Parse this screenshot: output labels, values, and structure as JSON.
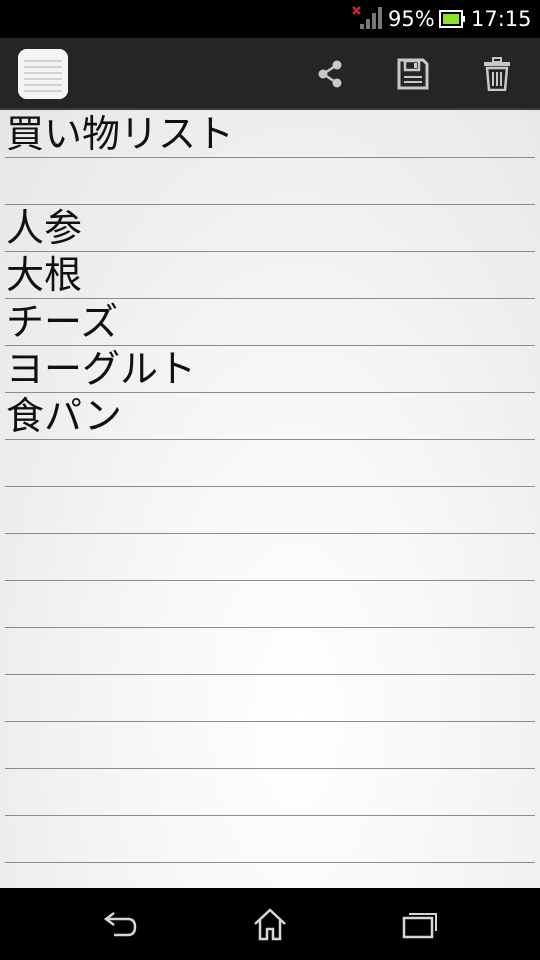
{
  "status_bar": {
    "battery_percent": "95%",
    "time": "17:15",
    "signal_icon": "signal-no-connection-icon",
    "battery_icon": "battery-icon"
  },
  "action_bar": {
    "app_icon": "notepad-icon",
    "actions": [
      {
        "name": "share",
        "icon": "share-icon"
      },
      {
        "name": "save",
        "icon": "save-icon"
      },
      {
        "name": "delete",
        "icon": "trash-icon"
      }
    ]
  },
  "note": {
    "title": "買い物リスト",
    "lines": [
      "",
      "人参",
      "大根",
      "チーズ",
      "ヨーグルト",
      "食パン"
    ]
  },
  "nav_bar": {
    "buttons": [
      {
        "name": "back",
        "icon": "back-icon"
      },
      {
        "name": "home",
        "icon": "home-icon"
      },
      {
        "name": "recents",
        "icon": "recent-apps-icon"
      }
    ]
  },
  "colors": {
    "status_bar_bg": "#000000",
    "action_bar_bg": "#252525",
    "note_bg": "#f0f0f0",
    "rule_line": "#8c8c8c",
    "signal_error": "#e02020"
  }
}
